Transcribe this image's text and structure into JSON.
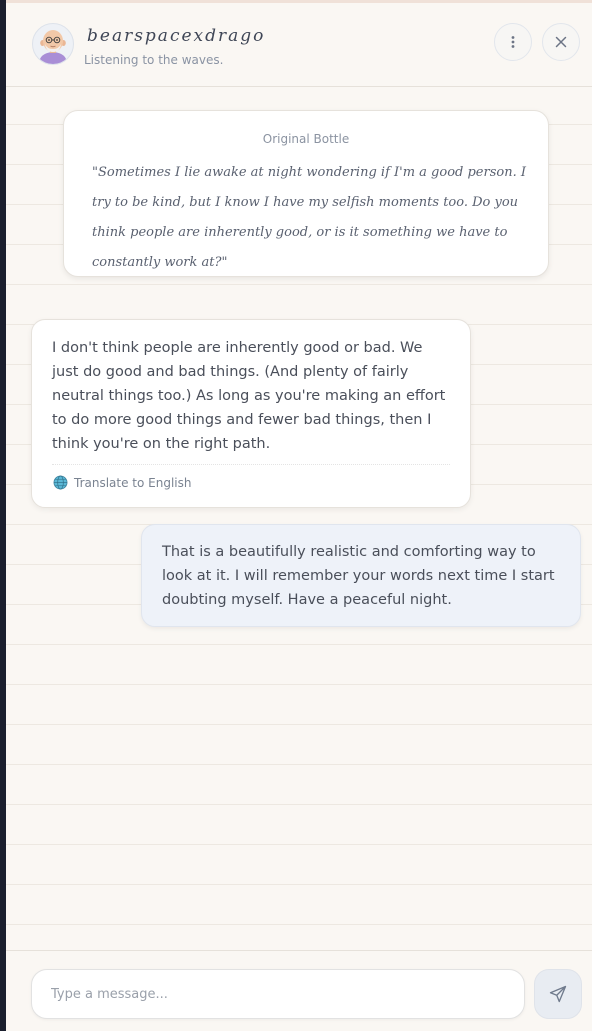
{
  "header": {
    "username": "bearspacexdrago",
    "status": "Listening to the waves."
  },
  "original_bottle": {
    "label": "Original Bottle",
    "text": "\"Sometimes I lie awake at night wondering if I'm a good person. I try to be kind, but I know I have my selfish moments too. Do you think people are inherently good, or is it something we have to constantly work at?\""
  },
  "messages": [
    {
      "direction": "incoming",
      "text": "I don't think people are inherently good or bad. We just do good and bad things. (And plenty of fairly neutral things too.) As long as you're making an effort to do more good things and fewer bad things, then I think you're on the right path.",
      "translate_label": "Translate to English"
    },
    {
      "direction": "outgoing",
      "text": "That is a beautifully realistic and comforting way to look at it. I will remember your words next time I start doubting myself. Have a peaceful night."
    }
  ],
  "composer": {
    "placeholder": "Type a message..."
  },
  "icons": {
    "avatar": "bald-man-avatar-icon",
    "more": "more-vertical-icon",
    "close": "close-icon",
    "translate": "globe-icon",
    "send": "send-icon"
  },
  "colors": {
    "background": "#faf7f3",
    "outgoing_bubble": "#eef2f9",
    "incoming_bubble": "#ffffff",
    "accent": "#8c96a8"
  }
}
